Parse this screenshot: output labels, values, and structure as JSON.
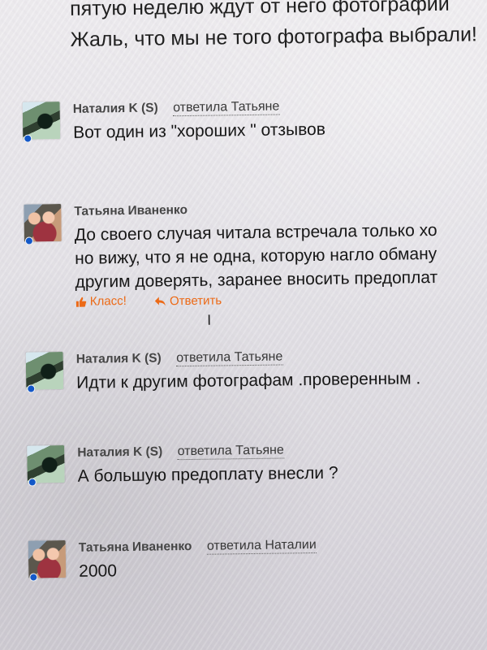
{
  "top_message": {
    "line1": "пятую неделю ждут от него фотографий",
    "line2": "Жаль, что мы не того фотографа выбрали!"
  },
  "comments": [
    {
      "author": "Наталия K (S)",
      "reply": "ответила Татьяне",
      "text": "Вот один из \"хороших \" отзывов"
    },
    {
      "author": "Татьяна Иваненко",
      "line1": "До своего случая читала встречала только хо",
      "line2": "но вижу, что я не одна, которую нагло обману",
      "line3": "другим доверять, заранее вносить предоплат",
      "like": "Класс!",
      "reply_action": "Ответить"
    },
    {
      "author": "Наталия K (S)",
      "reply": "ответила Татьяне",
      "text": "Идти к другим фотографам .проверенным ."
    },
    {
      "author": "Наталия K (S)",
      "reply": "ответила Татьяне",
      "text": "А большую предоплату внесли ?"
    },
    {
      "author": "Татьяна Иваненко",
      "reply": "ответила Наталии",
      "text": "2000"
    }
  ],
  "colors": {
    "online": "#1358c8",
    "action": "#ec6a17"
  },
  "icons": {
    "like": "thumb-up-icon",
    "reply": "reply-arrow-icon",
    "cursor": "text-cursor-icon"
  }
}
